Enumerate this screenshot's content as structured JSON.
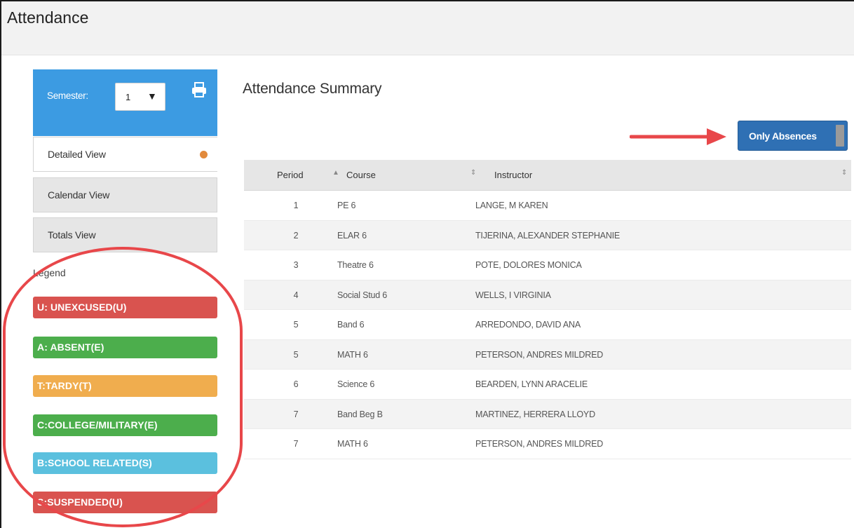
{
  "app": {
    "title": "Attendance"
  },
  "sidebar": {
    "semester_label": "Semester:",
    "semester_value": "1",
    "views": [
      {
        "label": "Detailed View",
        "active": true
      },
      {
        "label": "Calendar View",
        "active": false
      },
      {
        "label": "Totals View",
        "active": false
      }
    ],
    "legend_title": "Legend",
    "legend": [
      {
        "label": "U: UNEXCUSED(U)",
        "color": "#d9534f"
      },
      {
        "label": "A: ABSENT(E)",
        "color": "#4cae4c"
      },
      {
        "label": "T:TARDY(T)",
        "color": "#f0ad4e"
      },
      {
        "label": "C:COLLEGE/MILITARY(E)",
        "color": "#4cae4c"
      },
      {
        "label": "B:SCHOOL RELATED(S)",
        "color": "#5bc0de"
      },
      {
        "label": "S:SUSPENDED(U)",
        "color": "#d9534f"
      }
    ]
  },
  "main": {
    "title": "Attendance Summary",
    "only_absences_label": "Only Absences",
    "columns": [
      "Period",
      "Course",
      "Instructor"
    ],
    "rows": [
      {
        "period": "1",
        "course": "PE 6",
        "instructor": "LANGE, M KAREN"
      },
      {
        "period": "2",
        "course": "ELAR 6",
        "instructor": "TIJERINA, ALEXANDER STEPHANIE"
      },
      {
        "period": "3",
        "course": "Theatre 6",
        "instructor": "POTE, DOLORES MONICA"
      },
      {
        "period": "4",
        "course": "Social Stud 6",
        "instructor": "WELLS, I VIRGINIA"
      },
      {
        "period": "5",
        "course": "Band 6",
        "instructor": "ARREDONDO, DAVID ANA"
      },
      {
        "period": "5",
        "course": "MATH 6",
        "instructor": "PETERSON, ANDRES MILDRED"
      },
      {
        "period": "6",
        "course": "Science 6",
        "instructor": "BEARDEN, LYNN ARACELIE"
      },
      {
        "period": "7",
        "course": "Band Beg B",
        "instructor": "MARTINEZ, HERRERA LLOYD"
      },
      {
        "period": "7",
        "course": "MATH 6",
        "instructor": "PETERSON, ANDRES MILDRED"
      }
    ]
  },
  "colors": {
    "primary": "#3c9be2",
    "button": "#2f70b4",
    "annotation": "#e8474a"
  }
}
